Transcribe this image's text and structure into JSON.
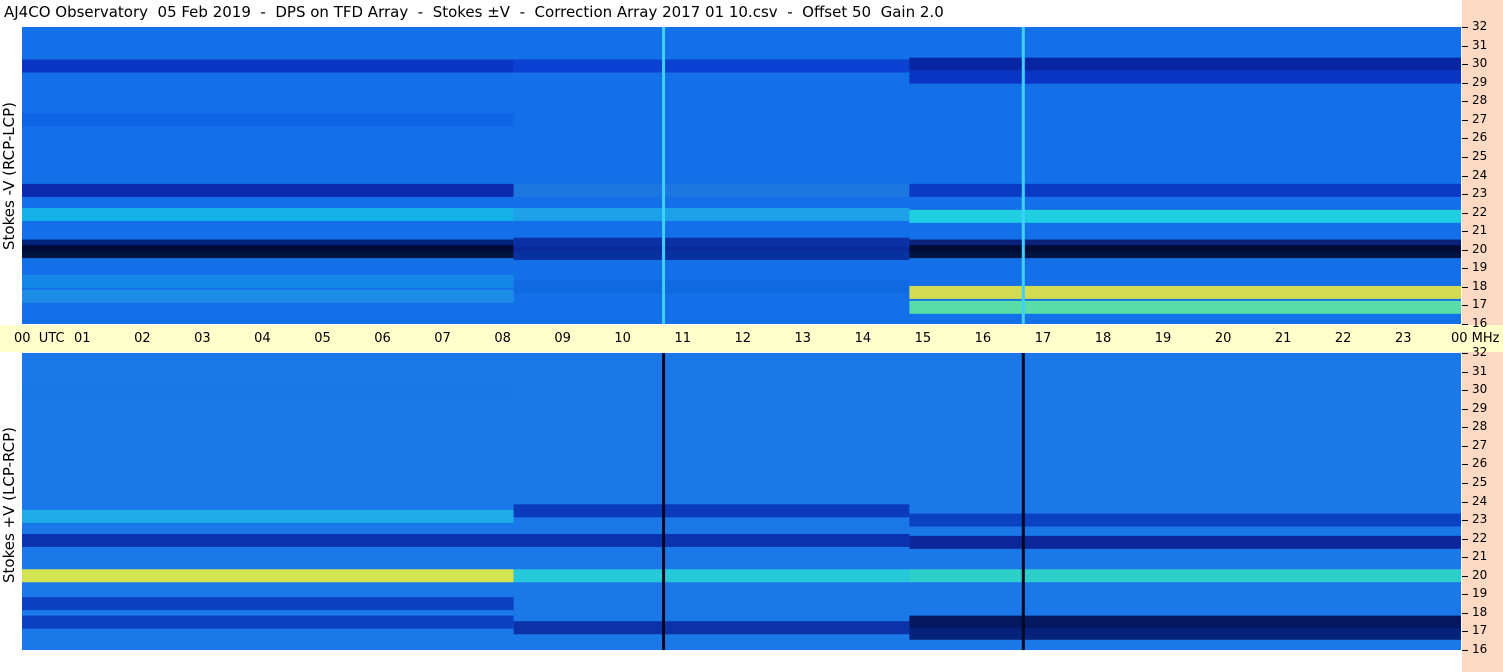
{
  "title": "AJ4CO Observatory  05 Feb 2019  -  DPS on TFD Array  -  Stokes ±V  -  Correction Array 2017 01 10.csv  -  Offset 50  Gain 2.0",
  "chart_data": [
    {
      "type": "heatmap",
      "panel": "top",
      "ylabel": "Stokes -V (RCP-LCP)",
      "x_axis_unit": "UTC",
      "x_ticks": [
        "00",
        "01",
        "02",
        "03",
        "04",
        "05",
        "06",
        "07",
        "08",
        "09",
        "10",
        "11",
        "12",
        "13",
        "14",
        "15",
        "16",
        "17",
        "18",
        "19",
        "20",
        "21",
        "22",
        "23",
        "00"
      ],
      "y_axis_unit": "MHz",
      "y_ticks": [
        16,
        17,
        18,
        19,
        20,
        21,
        22,
        23,
        24,
        25,
        26,
        27,
        28,
        29,
        30,
        31,
        32
      ],
      "ylim": [
        16,
        32
      ],
      "xlim_hours": [
        0,
        24
      ],
      "vertical_lines_utc": [
        10.7,
        16.7
      ],
      "vertical_line_color": "#3fd0ff",
      "segments": [
        {
          "x": [
            0,
            8.2
          ],
          "bands": [
            {
              "f": 29.9,
              "c": "#0a2fc0"
            },
            {
              "f": 27.0,
              "c": "#0f63e6"
            },
            {
              "f": 23.2,
              "c": "#0a22a6"
            },
            {
              "f": 21.9,
              "c": "#14b8e8"
            },
            {
              "f": 20.2,
              "c": "#001a70"
            },
            {
              "f": 19.9,
              "c": "#000a30"
            },
            {
              "f": 18.3,
              "c": "#1488e8"
            },
            {
              "f": 17.5,
              "c": "#1e90e8"
            }
          ]
        },
        {
          "x": [
            8.2,
            14.8
          ],
          "bands": [
            {
              "f": 29.9,
              "c": "#0a3cd0"
            },
            {
              "f": 23.2,
              "c": "#1e78e0"
            },
            {
              "f": 21.9,
              "c": "#1ea6e8"
            },
            {
              "f": 20.3,
              "c": "#0a2aa0"
            },
            {
              "f": 19.8,
              "c": "#082a9a"
            },
            {
              "f": 18.0,
              "c": "#0e68e0"
            }
          ]
        },
        {
          "x": [
            14.8,
            24
          ],
          "bands": [
            {
              "f": 30.0,
              "c": "#081e9a"
            },
            {
              "f": 29.3,
              "c": "#0a2fc0"
            },
            {
              "f": 23.2,
              "c": "#0a34c0"
            },
            {
              "f": 21.8,
              "c": "#20d8e0"
            },
            {
              "f": 20.2,
              "c": "#0a1a70"
            },
            {
              "f": 19.9,
              "c": "#000a30"
            },
            {
              "f": 17.7,
              "c": "#e8e840"
            },
            {
              "f": 16.9,
              "c": "#60e8a0"
            }
          ]
        }
      ],
      "background": "#1470e8"
    },
    {
      "type": "heatmap",
      "panel": "bottom",
      "ylabel": "Stokes +V (LCP-RCP)",
      "x_axis_unit": "UTC",
      "y_axis_unit": "MHz",
      "y_ticks": [
        16,
        17,
        18,
        19,
        20,
        21,
        22,
        23,
        24,
        25,
        26,
        27,
        28,
        29,
        30,
        31,
        32
      ],
      "ylim": [
        16,
        32
      ],
      "xlim_hours": [
        0,
        24
      ],
      "vertical_lines_utc": [
        10.7,
        16.7
      ],
      "vertical_line_color": "#000820",
      "segments": [
        {
          "x": [
            0,
            8.2
          ],
          "bands": [
            {
              "f": 29.9,
              "c": "#1a78e8"
            },
            {
              "f": 23.2,
              "c": "#20b0e8"
            },
            {
              "f": 21.9,
              "c": "#0a2aa8"
            },
            {
              "f": 20.0,
              "c": "#e8f040"
            },
            {
              "f": 18.5,
              "c": "#0a3cc0"
            },
            {
              "f": 17.5,
              "c": "#0a3cc0"
            }
          ]
        },
        {
          "x": [
            8.2,
            14.8
          ],
          "bands": [
            {
              "f": 23.5,
              "c": "#0a34b8"
            },
            {
              "f": 21.9,
              "c": "#0a2aa8"
            },
            {
              "f": 20.0,
              "c": "#28d0d8"
            },
            {
              "f": 17.2,
              "c": "#0a2aa0"
            }
          ]
        },
        {
          "x": [
            14.8,
            24
          ],
          "bands": [
            {
              "f": 23.0,
              "c": "#0a3cc0"
            },
            {
              "f": 21.8,
              "c": "#0a1e90"
            },
            {
              "f": 20.0,
              "c": "#30d8c8"
            },
            {
              "f": 17.5,
              "c": "#020c50"
            },
            {
              "f": 16.9,
              "c": "#041a70"
            }
          ]
        }
      ],
      "background": "#1a78e8"
    }
  ]
}
